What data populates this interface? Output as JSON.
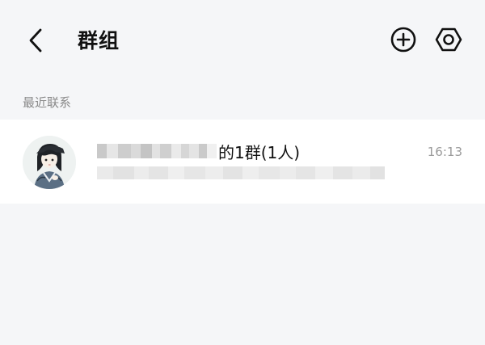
{
  "header": {
    "title": "群组",
    "back_icon": "chevron-left-icon",
    "add_icon": "plus-circle-icon",
    "settings_icon": "hexagon-settings-icon"
  },
  "section": {
    "label": "最近联系"
  },
  "groups": [
    {
      "name_visible": "的1群(1人)",
      "time": "16:13",
      "avatar_icon": "anime-girl-avatar-icon"
    }
  ],
  "colors": {
    "background": "#f5f6f8",
    "card": "#ffffff",
    "title": "#111111",
    "muted": "#8a8a8a",
    "timestamp": "#9a9a9a"
  }
}
